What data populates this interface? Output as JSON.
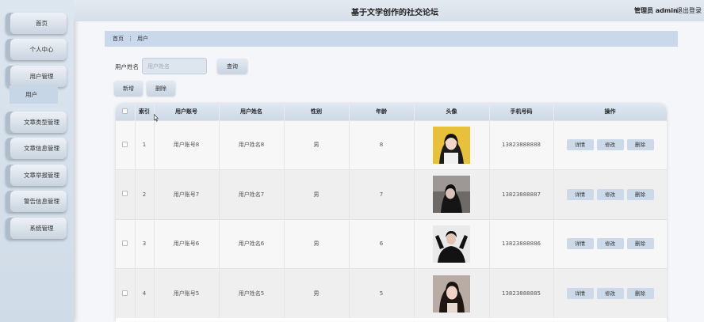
{
  "header": {
    "title": "基于文学创作的社交论坛",
    "admin": "管理员 admin",
    "logout": "退出登录"
  },
  "sidebar": {
    "items": [
      {
        "label": "首页"
      },
      {
        "label": "个人中心"
      },
      {
        "label": "用户管理"
      },
      {
        "label": "文章类型管理"
      },
      {
        "label": "文章信息管理"
      },
      {
        "label": "文章举报管理"
      },
      {
        "label": "警告信息管理"
      },
      {
        "label": "系统管理"
      }
    ],
    "submenu": {
      "label": "用户"
    }
  },
  "breadcrumb": {
    "home": "首页",
    "separator": "⋮",
    "current": "用户"
  },
  "search": {
    "label": "用户姓名",
    "placeholder": "用户姓名",
    "query_label": "查询"
  },
  "toolbar": {
    "add_label": "新增",
    "delete_label": "删除"
  },
  "table": {
    "columns": [
      "索引",
      "用户账号",
      "用户姓名",
      "性别",
      "年龄",
      "头像",
      "手机号码",
      "操作"
    ],
    "actions": {
      "detail": "详情",
      "edit": "修改",
      "delete": "删除"
    },
    "rows": [
      {
        "index": "1",
        "account": "用户账号8",
        "name": "用户姓名8",
        "gender": "男",
        "age": "8",
        "phone": "13823888888"
      },
      {
        "index": "2",
        "account": "用户账号7",
        "name": "用户姓名7",
        "gender": "男",
        "age": "7",
        "phone": "13823888887"
      },
      {
        "index": "3",
        "account": "用户账号6",
        "name": "用户姓名6",
        "gender": "男",
        "age": "6",
        "phone": "13823888886"
      },
      {
        "index": "4",
        "account": "用户账号5",
        "name": "用户姓名5",
        "gender": "男",
        "age": "5",
        "phone": "13823888885"
      }
    ]
  },
  "colors": {
    "accent": "#c9d8ea",
    "button": "#cbd9e8",
    "sidebar": "#dde6ef"
  }
}
